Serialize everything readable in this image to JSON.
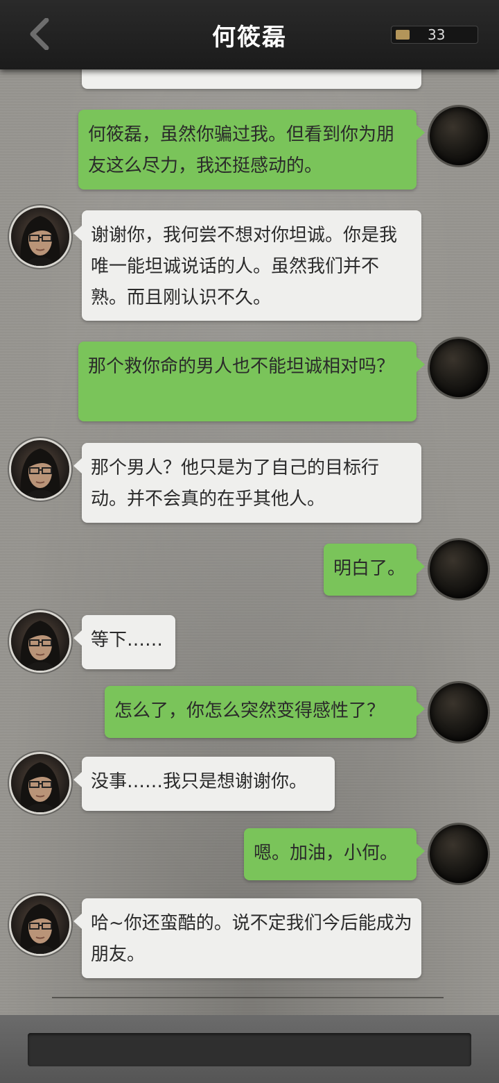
{
  "header": {
    "title": "何筱磊",
    "coins": "33",
    "back_icon": "chevron-left-icon",
    "coin_icon": "coin-icon"
  },
  "messages": [
    {
      "side": "right",
      "text": "何筱磊，虽然你骗过我。但看到你为朋友这么尽力，我还挺感动的。"
    },
    {
      "side": "left",
      "text": "谢谢你，我何尝不想对你坦诚。你是我唯一能坦诚说话的人。虽然我们并不熟。而且刚认识不久。"
    },
    {
      "side": "right",
      "text": "那个救你命的男人也不能坦诚相对吗？"
    },
    {
      "side": "left",
      "text": "那个男人？他只是为了自己的目标行动。并不会真的在乎其他人。"
    },
    {
      "side": "right",
      "text": "明白了。"
    },
    {
      "side": "left",
      "text": "等下……"
    },
    {
      "side": "right",
      "text": "怎么了，你怎么突然变得感性了？"
    },
    {
      "side": "left",
      "text": "没事……我只是想谢谢你。"
    },
    {
      "side": "right",
      "text": "嗯。加油，小何。"
    },
    {
      "side": "left",
      "text": "哈~你还蛮酷的。说不定我们今后能成为朋友。"
    }
  ],
  "colors": {
    "player_bubble": "#7ac45a",
    "npc_bubble": "#efefed",
    "header_bg": "#1f1f1f"
  }
}
